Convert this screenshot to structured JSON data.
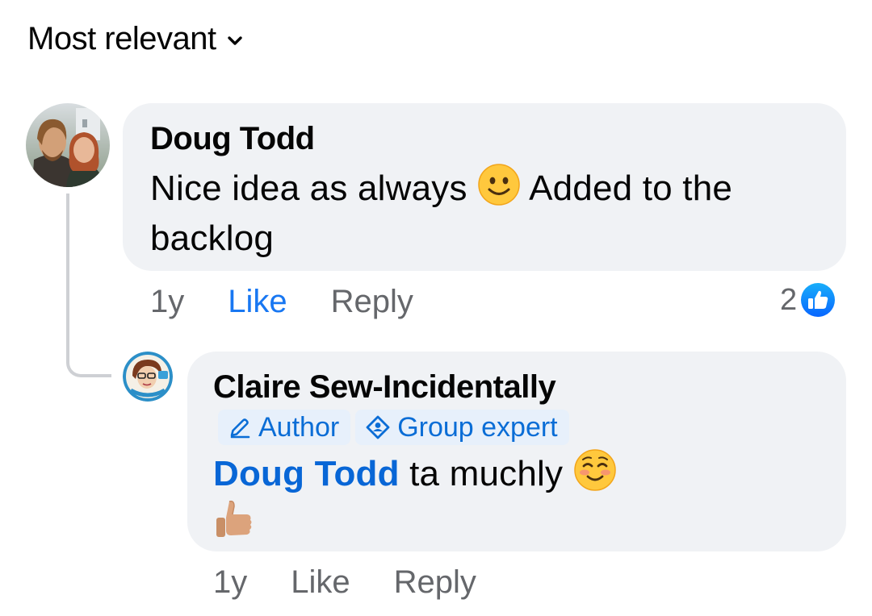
{
  "sort": {
    "label": "Most relevant",
    "icon": "chevron-down-icon"
  },
  "comments": [
    {
      "author": "Doug Todd",
      "text_before": "Nice idea as always",
      "text_after": "Added to the backlog",
      "emoji": "slightly-smiling-face",
      "time": "1y",
      "like_label": "Like",
      "reply_label": "Reply",
      "reaction_count": "2",
      "reaction_icon": "like-reaction-icon"
    }
  ],
  "reply": {
    "author": "Claire Sew-Incidentally",
    "badges": [
      {
        "label": "Author",
        "icon": "pencil-icon"
      },
      {
        "label": "Group expert",
        "icon": "expert-badge-icon"
      }
    ],
    "mention": "Doug Todd",
    "text": "ta muchly",
    "emoji_1": "smiling-face-with-smiling-eyes",
    "emoji_2": "thumbs-up-medium-light-skin",
    "time": "1y",
    "like_label": "Like",
    "reply_label": "Reply"
  },
  "colors": {
    "bubble": "#f0f2f5",
    "link_blue": "#1877f2",
    "mention_blue": "#0866d6",
    "badge_bg": "#e7f0fb",
    "meta_gray": "#65676b"
  }
}
